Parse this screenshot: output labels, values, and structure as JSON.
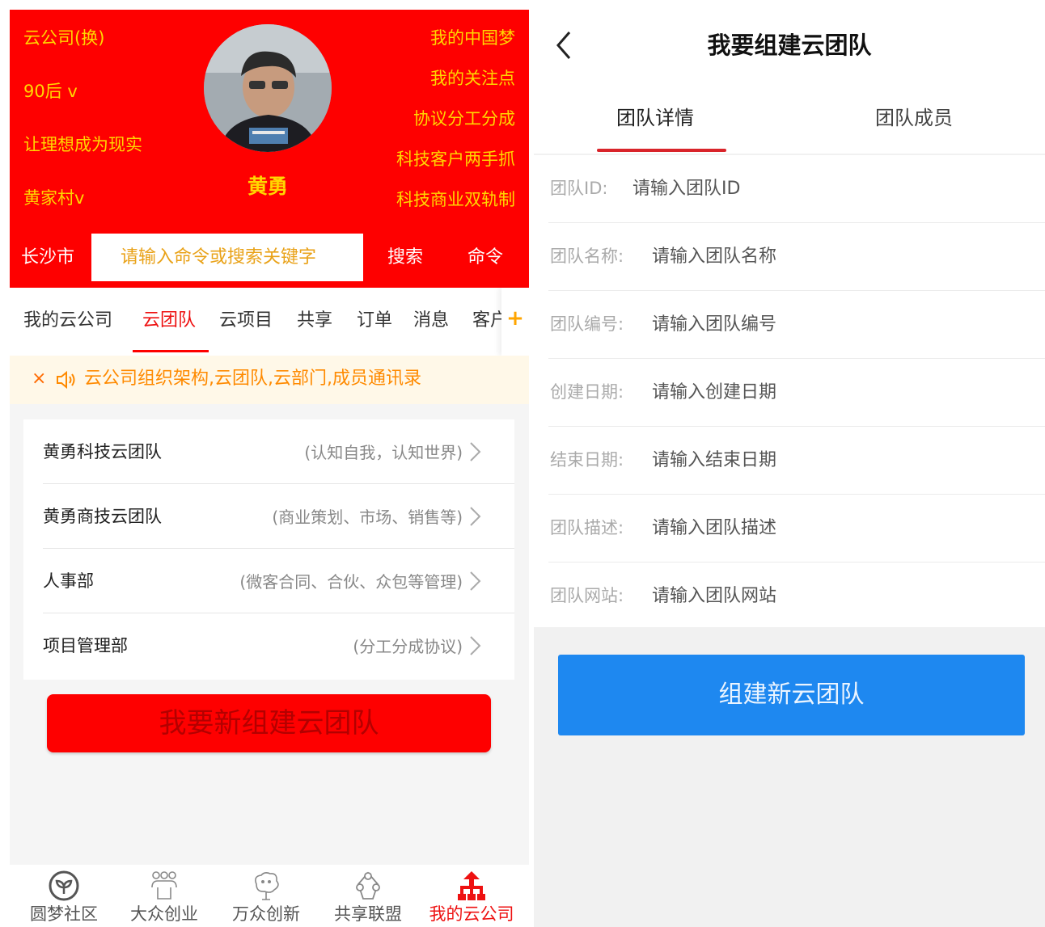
{
  "left": {
    "header": {
      "left_items": [
        "云公司(换)",
        "90后 v",
        "让理想成为现实",
        "黄家村v"
      ],
      "right_items": [
        "我的中国梦",
        "我的关注点",
        "协议分工分成",
        "科技客户两手抓",
        "科技商业双轨制"
      ],
      "user_name": "黄勇",
      "city": "长沙市",
      "search_placeholder": "请输入命令或搜索关键字",
      "search_label": "搜索",
      "command_label": "命令"
    },
    "tabs": [
      "我的云公司",
      "云团队",
      "云项目",
      "共享",
      "订单",
      "消息",
      "客户"
    ],
    "tabs_more": "+",
    "active_tab": "云团队",
    "notice": {
      "close": "×",
      "text": "云公司组织架构,云团队,云部门,成员通讯录"
    },
    "teams": [
      {
        "name": "黄勇科技云团队",
        "desc": "(认知自我，认知世界)"
      },
      {
        "name": "黄勇商技云团队",
        "desc": "(商业策划、市场、销售等)"
      },
      {
        "name": "人事部",
        "desc": "(微客合同、合伙、众包等管理)"
      },
      {
        "name": "项目管理部",
        "desc": "(分工分成协议)"
      }
    ],
    "new_team_button": "我要新组建云团队",
    "bottom_nav": [
      {
        "label": "圆梦社区",
        "icon": "community-icon"
      },
      {
        "label": "大众创业",
        "icon": "group-icon"
      },
      {
        "label": "万众创新",
        "icon": "idea-icon"
      },
      {
        "label": "共享联盟",
        "icon": "alliance-icon"
      },
      {
        "label": "我的云公司",
        "icon": "org-chart-icon"
      }
    ],
    "colors": {
      "primary_red": "#fe0000",
      "gold": "#ffd700",
      "notice_orange": "#ff8a00"
    }
  },
  "right": {
    "title": "我要组建云团队",
    "tabs": [
      "团队详情",
      "团队成员"
    ],
    "active_tab": "团队详情",
    "fields": [
      {
        "label": "团队ID:",
        "placeholder": "请输入团队ID"
      },
      {
        "label": "团队名称:",
        "placeholder": "请输入团队名称"
      },
      {
        "label": "团队编号:",
        "placeholder": "请输入团队编号"
      },
      {
        "label": "创建日期:",
        "placeholder": "请输入创建日期"
      },
      {
        "label": "结束日期:",
        "placeholder": "请输入结束日期"
      },
      {
        "label": "团队描述:",
        "placeholder": "请输入团队描述"
      },
      {
        "label": "团队网站:",
        "placeholder": "请输入团队网站"
      }
    ],
    "submit_button": "组建新云团队",
    "colors": {
      "submit_blue": "#1e88f0",
      "tab_underline": "#d9242a"
    }
  }
}
